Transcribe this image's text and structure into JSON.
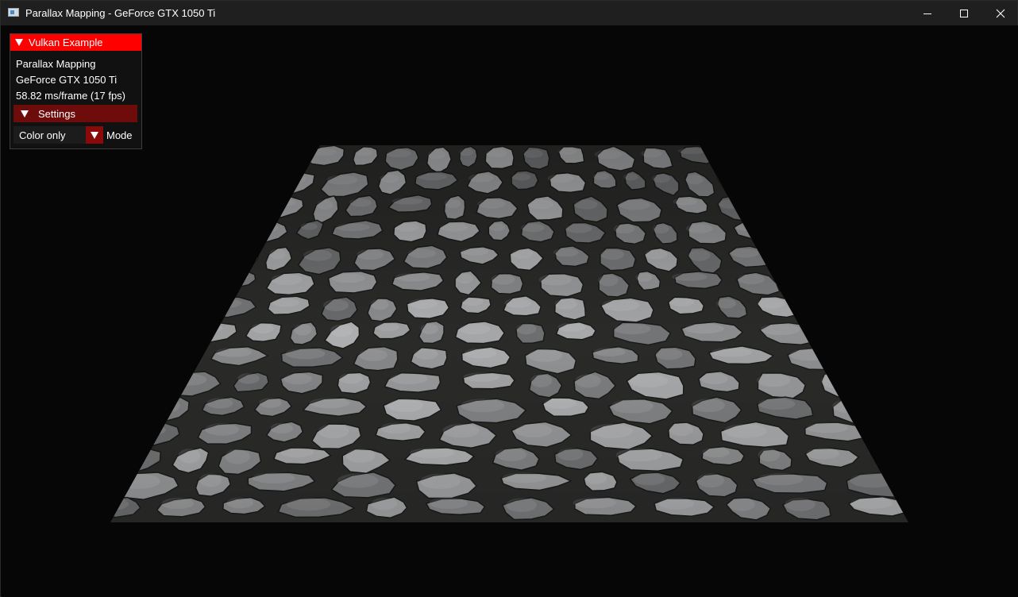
{
  "window": {
    "title": "Parallax Mapping - GeForce GTX 1050 Ti",
    "controls": {
      "minimize": "minimize-icon",
      "maximize": "maximize-icon",
      "close": "close-icon"
    }
  },
  "overlay": {
    "header": "Vulkan Example",
    "app_name": "Parallax Mapping",
    "gpu_name": "GeForce GTX 1050 Ti",
    "frame_stats": "58.82 ms/frame (17 fps)",
    "settings": {
      "header": "Settings",
      "mode_value": "Color only",
      "mode_label": "Mode"
    }
  },
  "colors": {
    "titlebar": "#1f1f1f",
    "background": "#060606",
    "overlay_header": "#ff0000",
    "settings_header": "#6e0b0b",
    "combo_button": "#8a0a0a"
  }
}
